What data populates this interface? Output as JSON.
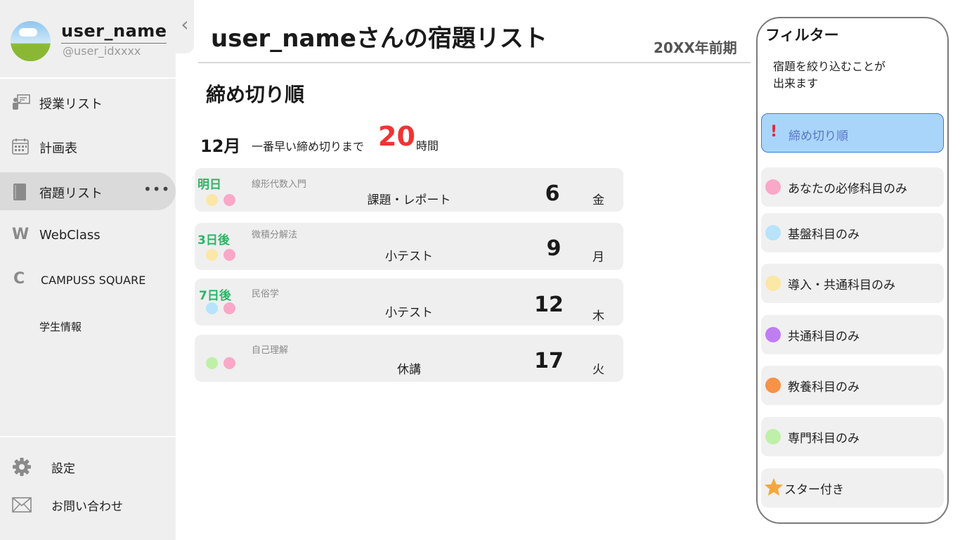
{
  "user": {
    "name": "user_name",
    "id": "@user_idxxxx"
  },
  "sidebar": {
    "items": [
      {
        "label": "授業リスト",
        "icon": "classroom-icon"
      },
      {
        "label": "計画表",
        "icon": "calendar-icon"
      },
      {
        "label": "宿題リスト",
        "icon": "book-icon",
        "active": true,
        "more": "•••"
      },
      {
        "label": "WebClass",
        "icon": "letter-w-icon",
        "letter": "W"
      },
      {
        "label": "CAMPUSS SQUARE",
        "icon": "letter-c-icon",
        "letter": "C"
      },
      {
        "label": "学生情報"
      }
    ],
    "bottom": [
      {
        "label": "設定",
        "icon": "gear-icon"
      },
      {
        "label": "お問い合わせ",
        "icon": "mail-icon"
      }
    ],
    "collapse_glyph": "‹"
  },
  "header": {
    "title": "user_nameさんの宿題リスト",
    "term": "20XX年前期"
  },
  "main": {
    "section_title": "締め切り順",
    "month": "12月",
    "until_label": "一番早い締め切りまで",
    "hours": "20",
    "hours_unit": "時間"
  },
  "homework": [
    {
      "relative": "明日",
      "course": "線形代数入門",
      "type": "課題・レポート",
      "day": "6",
      "weekday": "金",
      "dots": [
        "#fbe7a6",
        "#f9a8c8"
      ]
    },
    {
      "relative": "3日後",
      "course": "微積分解法",
      "type": "小テスト",
      "day": "9",
      "weekday": "月",
      "dots": [
        "#fbe7a6",
        "#f9a8c8"
      ]
    },
    {
      "relative": "7日後",
      "course": "民俗学",
      "type": "小テスト",
      "day": "12",
      "weekday": "木",
      "dots": [
        "#b8e3fb",
        "#f9a8c8"
      ]
    },
    {
      "relative": "",
      "course": "自己理解",
      "type": "休講",
      "day": "17",
      "weekday": "火",
      "dots": [
        "#bff0a8",
        "#f9a8c8"
      ]
    }
  ],
  "filter": {
    "title": "フィルター",
    "description": "宿題を絞り込むことが\n出来ます",
    "options": [
      {
        "label": "締め切り順",
        "active": true,
        "mark": "!"
      },
      {
        "label": "あなたの必修科目のみ",
        "color": "#f9a8c8"
      },
      {
        "label": "基盤科目のみ",
        "color": "#b8e3fb"
      },
      {
        "label": "導入・共通科目のみ",
        "color": "#fbe7a6"
      },
      {
        "label": "共通科目のみ",
        "color": "#bf7df2"
      },
      {
        "label": "教養科目のみ",
        "color": "#f99147"
      },
      {
        "label": "専門科目のみ",
        "color": "#bff0a8"
      },
      {
        "label": "スター付き",
        "icon": "star-icon",
        "color": "#f5a83a"
      }
    ]
  }
}
